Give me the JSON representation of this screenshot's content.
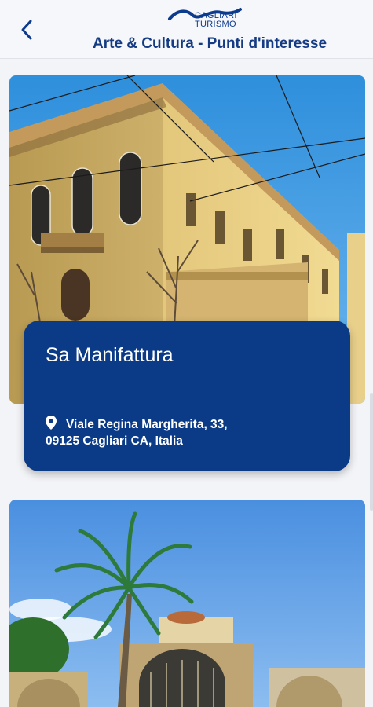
{
  "header": {
    "back_icon": "chevron-left-icon",
    "logo_line1": "CAGLIARI",
    "logo_line2": "TURISMO",
    "title": "Arte & Cultura - Punti d'interesse"
  },
  "cards": [
    {
      "name": "Sa Manifattura",
      "address_line1": "Viale Regina Margherita, 33,",
      "address_line2": "09125 Cagliari CA, Italia",
      "pin_icon": "location-pin-icon"
    }
  ],
  "colors": {
    "primary": "#0b3a86",
    "title": "#143b84",
    "background": "#f3f4f7"
  }
}
